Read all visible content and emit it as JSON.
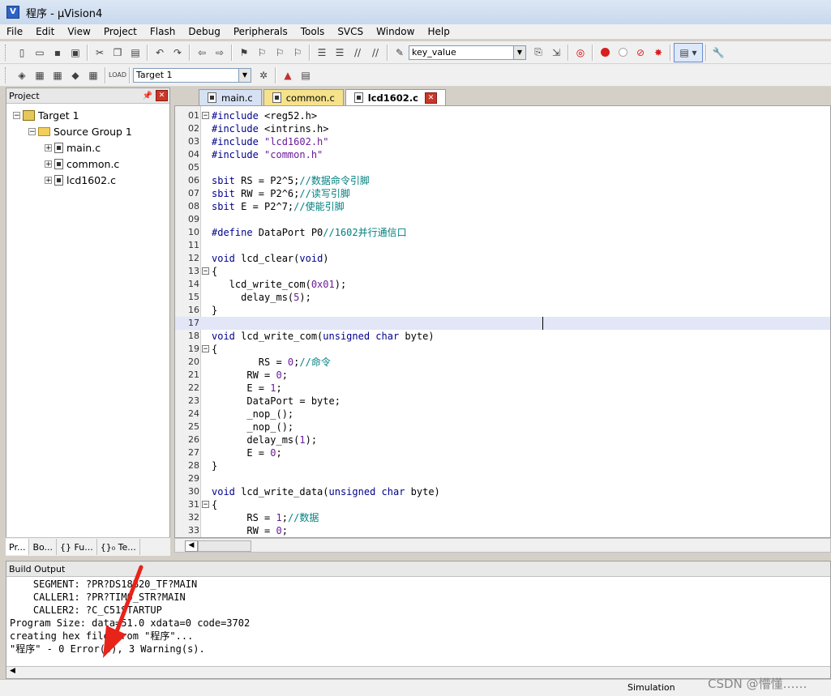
{
  "window": {
    "title": "程序 - μVision4"
  },
  "menu": [
    "File",
    "Edit",
    "View",
    "Project",
    "Flash",
    "Debug",
    "Peripherals",
    "Tools",
    "SVCS",
    "Window",
    "Help"
  ],
  "toolbar": {
    "find_value": "key_value",
    "target_select": "Target 1"
  },
  "project": {
    "header": "Project",
    "tree": [
      {
        "label": "Target 1",
        "depth": 0,
        "kind": "target",
        "expander": "−"
      },
      {
        "label": "Source Group 1",
        "depth": 1,
        "kind": "folder",
        "expander": "−"
      },
      {
        "label": "main.c",
        "depth": 2,
        "kind": "file",
        "expander": "+"
      },
      {
        "label": "common.c",
        "depth": 2,
        "kind": "file",
        "expander": "+"
      },
      {
        "label": "lcd1602.c",
        "depth": 2,
        "kind": "file",
        "expander": "+"
      }
    ],
    "tabs": [
      "Pr...",
      "Bo...",
      "{} Fu...",
      "{}₀ Te..."
    ]
  },
  "editor": {
    "tabs": [
      "main.c",
      "common.c",
      "lcd1602.c"
    ],
    "active_tab": "lcd1602.c",
    "lines": [
      {
        "n": "01",
        "fold": "−",
        "html": "<span class='kw'>#include</span> &lt;reg52.h&gt;"
      },
      {
        "n": "02",
        "html": "<span class='kw'>#include</span> &lt;intrins.h&gt;"
      },
      {
        "n": "03",
        "html": "<span class='kw'>#include</span> <span class='nm'>\"lcd1602.h\"</span>"
      },
      {
        "n": "04",
        "html": "<span class='kw'>#include</span> <span class='nm'>\"common.h\"</span>"
      },
      {
        "n": "05",
        "html": ""
      },
      {
        "n": "06",
        "html": "<span class='kw'>sbit</span> RS = P2^5;<span class='cm'>//数据命令引脚</span>"
      },
      {
        "n": "07",
        "html": "<span class='kw'>sbit</span> RW = P2^6;<span class='cm'>//读写引脚</span>"
      },
      {
        "n": "08",
        "html": "<span class='kw'>sbit</span> E = P2^7;<span class='cm'>//使能引脚</span>"
      },
      {
        "n": "09",
        "html": ""
      },
      {
        "n": "10",
        "html": "<span class='kw'>#define</span> DataPort P0<span class='cm'>//1602并行通信口</span>"
      },
      {
        "n": "11",
        "html": ""
      },
      {
        "n": "12",
        "html": "<span class='kw'>void</span> lcd_clear(<span class='kw'>void</span>)"
      },
      {
        "n": "13",
        "fold": "−",
        "html": "{"
      },
      {
        "n": "14",
        "html": "   lcd_write_com(<span class='nm'>0x01</span>);"
      },
      {
        "n": "15",
        "html": "     delay_ms(<span class='nm'>5</span>);"
      },
      {
        "n": "16",
        "html": "}"
      },
      {
        "n": "17",
        "hl": true,
        "html": ""
      },
      {
        "n": "18",
        "html": "<span class='kw'>void</span> lcd_write_com(<span class='kw'>unsigned char</span> byte)"
      },
      {
        "n": "19",
        "fold": "−",
        "html": "{"
      },
      {
        "n": "20",
        "html": "        RS = <span class='nm'>0</span>;<span class='cm'>//命令</span>"
      },
      {
        "n": "21",
        "html": "      RW = <span class='nm'>0</span>;"
      },
      {
        "n": "22",
        "html": "      E = <span class='nm'>1</span>;"
      },
      {
        "n": "23",
        "html": "      DataPort = byte;"
      },
      {
        "n": "24",
        "html": "      _nop_();"
      },
      {
        "n": "25",
        "html": "      _nop_();"
      },
      {
        "n": "26",
        "html": "      delay_ms(<span class='nm'>1</span>);"
      },
      {
        "n": "27",
        "html": "      E = <span class='nm'>0</span>;"
      },
      {
        "n": "28",
        "html": "}"
      },
      {
        "n": "29",
        "html": ""
      },
      {
        "n": "30",
        "html": "<span class='kw'>void</span> lcd_write_data(<span class='kw'>unsigned char</span> byte)"
      },
      {
        "n": "31",
        "fold": "−",
        "html": "{"
      },
      {
        "n": "32",
        "html": "      RS = <span class='nm'>1</span>;<span class='cm'>//数据</span>"
      },
      {
        "n": "33",
        "html": "      RW = <span class='nm'>0</span>;"
      }
    ]
  },
  "build": {
    "header": "Build Output",
    "lines": [
      "    SEGMENT: ?PR?DS18B20_TF?MAIN",
      "    CALLER1: ?PR?TIM0_STR?MAIN",
      "    CALLER2: ?C_C51STARTUP",
      "Program Size: data=51.0 xdata=0 code=3702",
      "creating hex file from \"程序\"...",
      "\"程序\" - 0 Error(s), 3 Warning(s)."
    ]
  },
  "status": {
    "mode": "Simulation",
    "watermark": "CSDN @懵懂……"
  }
}
